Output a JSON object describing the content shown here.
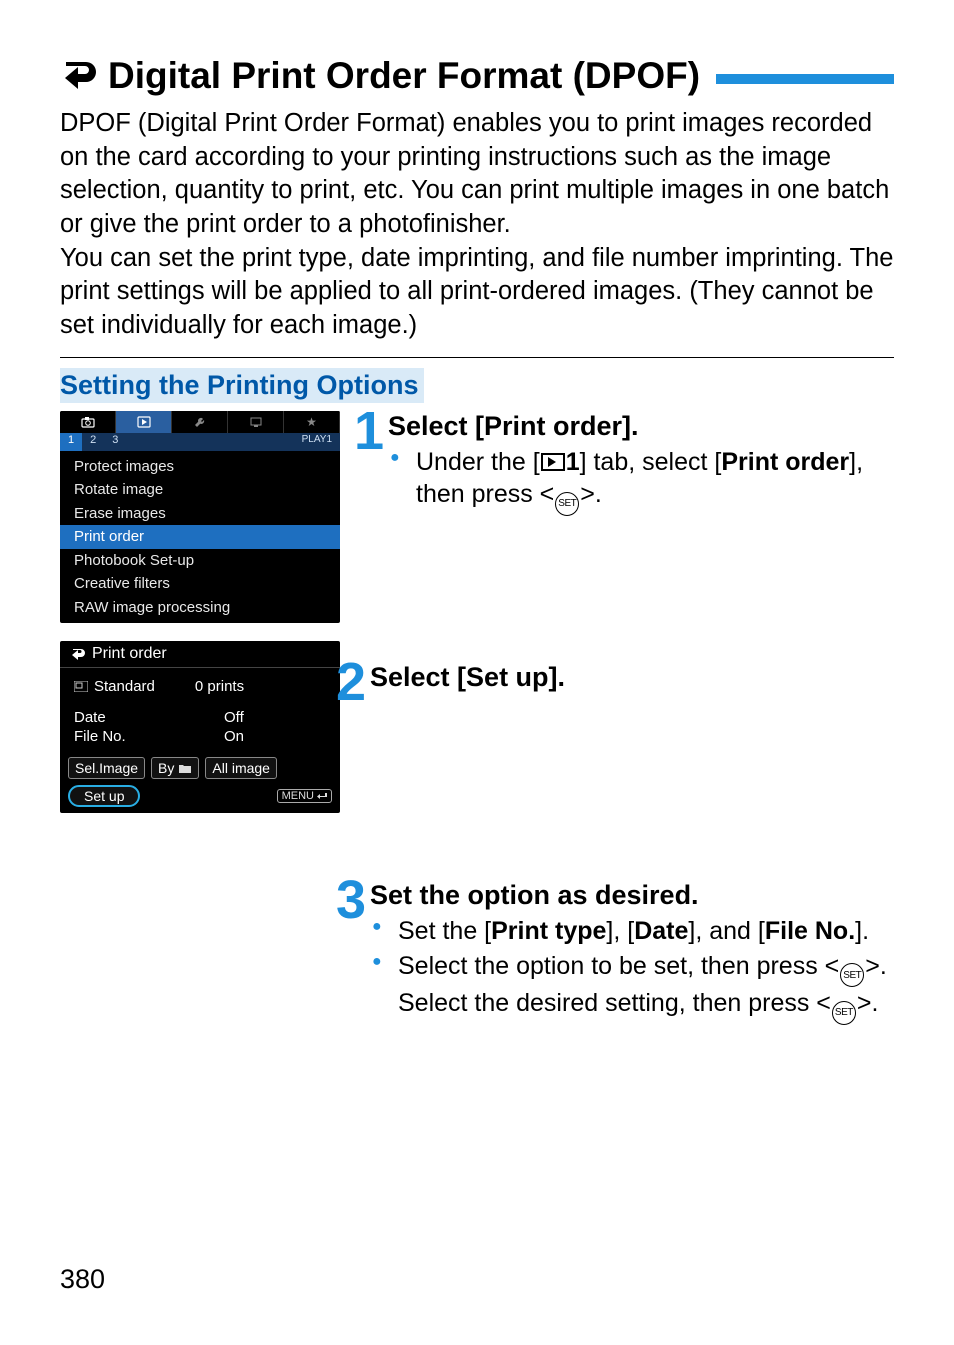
{
  "page_number": "380",
  "title": "Digital Print Order Format (DPOF)",
  "intro": "DPOF (Digital Print Order Format) enables you to print images recorded on the card according to your printing instructions such as the image selection, quantity to print, etc. You can print multiple images in one batch or give the print order to a photofinisher.\nYou can set the print type, date imprinting, and file number imprinting. The print settings will be applied to all print-ordered images. (They cannot be set individually for each image.)",
  "section_title": "Setting the Printing Options",
  "menu": {
    "sub_tab_label": "PLAY1",
    "items": [
      "Protect images",
      "Rotate image",
      "Erase images",
      "Print order",
      "Photobook Set-up",
      "Creative filters",
      "RAW image processing"
    ],
    "selected_index": 3
  },
  "order": {
    "title": "Print order",
    "type_label": "Standard",
    "prints": "0 prints",
    "date_label": "Date",
    "date_val": "Off",
    "fileno_label": "File No.",
    "fileno_val": "On",
    "btn_sel": "Sel.Image",
    "btn_by": "By",
    "btn_all": "All image",
    "btn_setup": "Set up",
    "menu_label": "MENU"
  },
  "steps": [
    {
      "num": "1",
      "title": "Select [Print order].",
      "bullets": [
        {
          "pre": "Under the [",
          "icon": "play-tab",
          "mid": "1",
          "post": "] tab, select [",
          "bold1": "Print order",
          "post2": "], then press <",
          "icon2": "set",
          "post3": ">."
        }
      ]
    },
    {
      "num": "2",
      "title": "Select [Set up]."
    },
    {
      "num": "3",
      "title": "Set the option as desired.",
      "bullets": [
        {
          "pre": "Set the [",
          "bold1": "Print type",
          "mid": "], [",
          "bold2": "Date",
          "mid2": "], and [",
          "bold3": "File No.",
          "post": "]."
        },
        {
          "pre": "Select the option to be set, then press <",
          "icon": "set",
          "mid": ">. Select the desired setting, then press <",
          "icon2": "set",
          "post": ">."
        }
      ]
    }
  ]
}
